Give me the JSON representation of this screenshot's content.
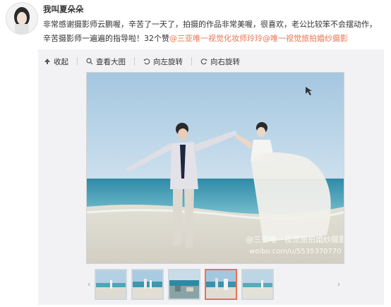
{
  "post": {
    "username": "我叫夏朵朵",
    "line1": "非常感谢摄影师云鹏喔，辛苦了一天了，拍摄的作品非常美喔，很喜欢，老公比较笨不会摆动作，",
    "line2_prefix": "辛苦摄影师一遍遍的指导啦！32个赞",
    "mention_1": "@三亚唯一视觉化妆师玲玲",
    "mention_2": "@唯一视觉旅拍婚纱摄影"
  },
  "toolbar": {
    "collect": "收起",
    "view_large": "查看大图",
    "rotate_left": "向左旋转",
    "rotate_right": "向右旋转"
  },
  "photo": {
    "watermark": "@三亚唯一视觉旅拍婚纱摄影",
    "watermark_url": "weibo.com/u/5535370770"
  },
  "gallery": {
    "thumb_count": 5,
    "active_index": 3,
    "prev_icon": "chevron-left-icon",
    "next_icon": "chevron-right-icon"
  },
  "colors": {
    "accent": "#eb7350",
    "sky": "#9ac2de",
    "sea": "#4b9cb3",
    "sand": "#e7e4da",
    "panel": "#f2f2f5"
  }
}
